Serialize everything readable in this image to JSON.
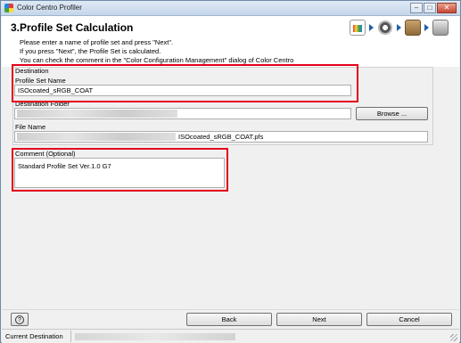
{
  "window": {
    "title": "Color Centro Profiler",
    "controls": [
      "–",
      "□",
      "✕"
    ]
  },
  "header": {
    "step_title": "3.Profile Set Calculation",
    "lines": [
      "Please enter a name of profile set and press \"Next\".",
      "If you press \"Next\", the Profile Set is calculated.",
      "You can check the comment in the \"Color Configuration Management\" dialog of Color Centro"
    ],
    "step_icons": [
      "profile-document-icon",
      "gear-icon",
      "package-icon",
      "printer-icon"
    ]
  },
  "destination": {
    "group_label": "Destination",
    "profile_set_name_label": "Profile Set Name",
    "profile_set_name_value": "ISOcoated_sRGB_COAT",
    "destination_folder_label": "Destination Folder",
    "browse_label": "Browse ...",
    "file_name_label": "File Name",
    "file_name_value": "ISOcoated_sRGB_COAT.pfs"
  },
  "comment": {
    "label": "Comment (Optional)",
    "value": "Standard Profile Set Ver.1.0 G7"
  },
  "footer": {
    "help_label": "?",
    "back_label": "Back",
    "next_label": "Next",
    "cancel_label": "Cancel"
  },
  "status": {
    "label": "Current Destination"
  },
  "colors": {
    "highlight": "#e3001b",
    "accent": "#1e5fa8"
  }
}
